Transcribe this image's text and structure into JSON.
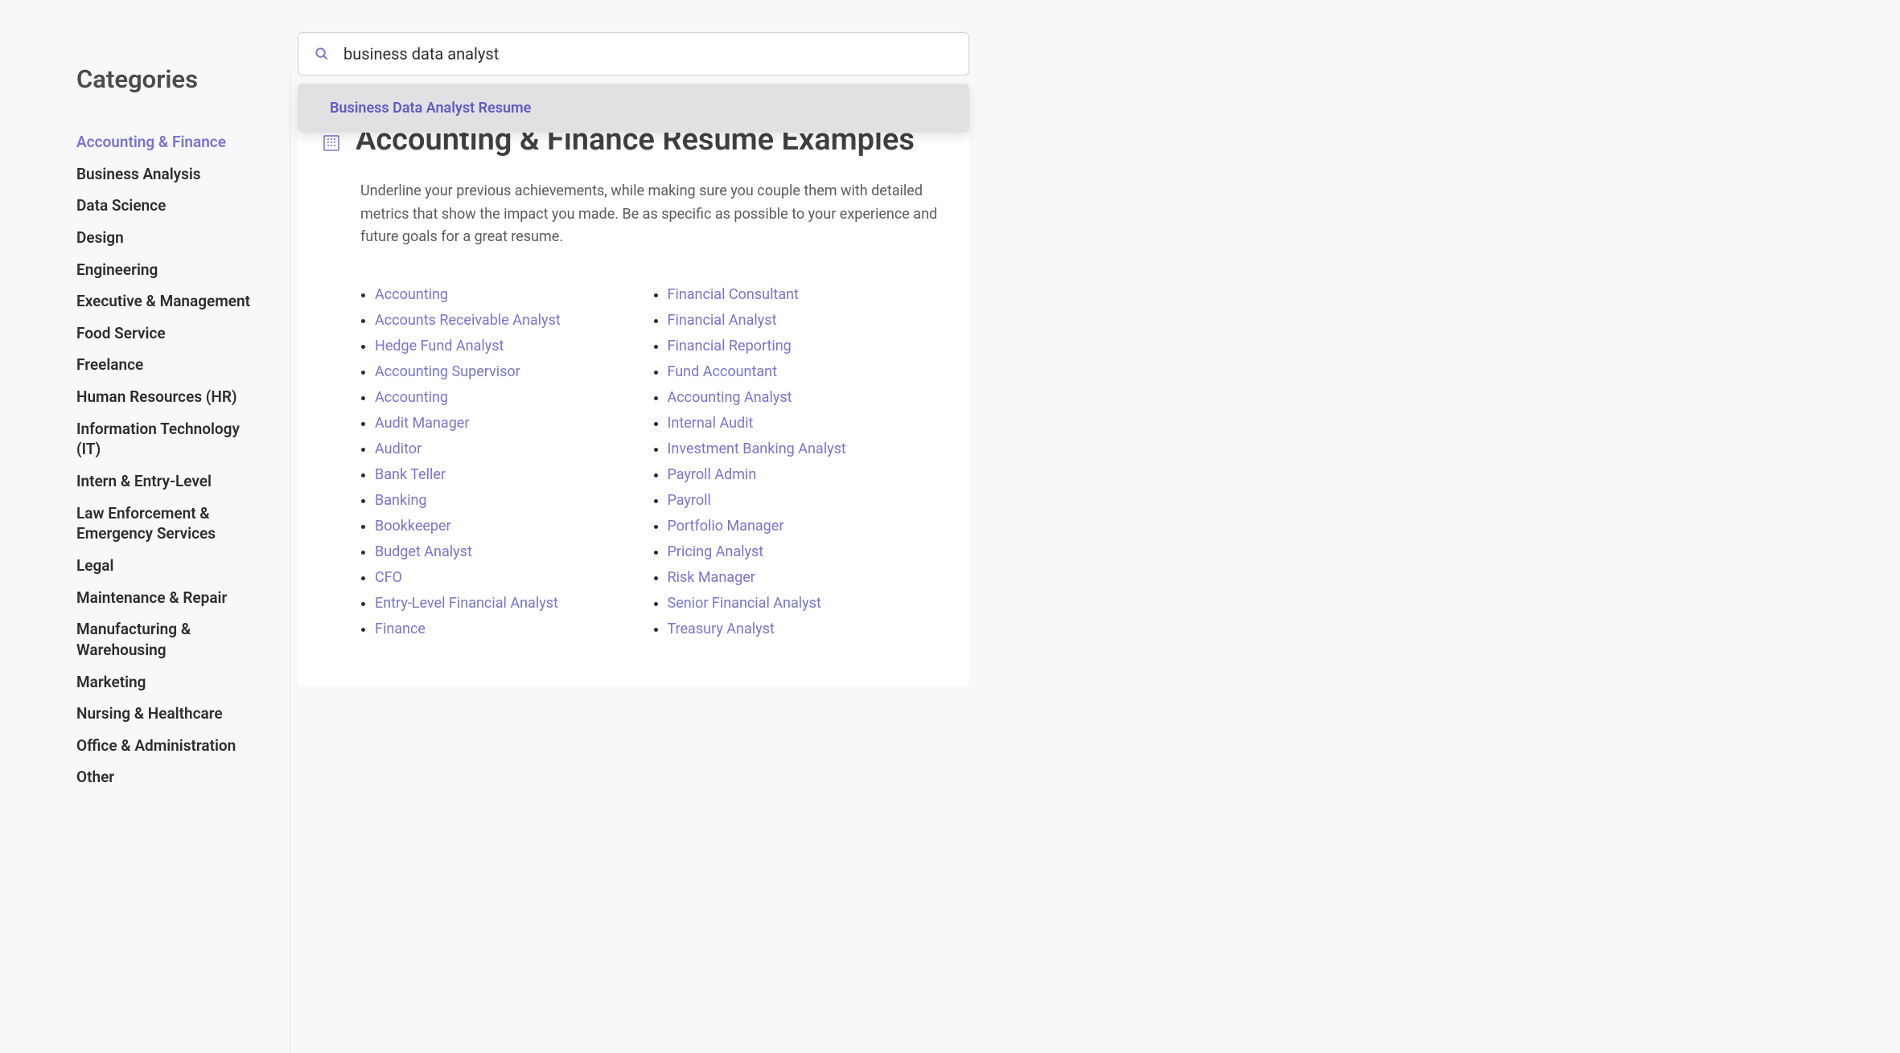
{
  "sidebar": {
    "heading": "Categories",
    "items": [
      {
        "label": "Accounting & Finance",
        "active": true
      },
      {
        "label": "Business Analysis",
        "active": false
      },
      {
        "label": "Data Science",
        "active": false
      },
      {
        "label": "Design",
        "active": false
      },
      {
        "label": "Engineering",
        "active": false
      },
      {
        "label": "Executive & Management",
        "active": false
      },
      {
        "label": "Food Service",
        "active": false
      },
      {
        "label": "Freelance",
        "active": false
      },
      {
        "label": "Human Resources (HR)",
        "active": false
      },
      {
        "label": "Information Technology (IT)",
        "active": false
      },
      {
        "label": "Intern & Entry-Level",
        "active": false
      },
      {
        "label": "Law Enforcement & Emergency Services",
        "active": false
      },
      {
        "label": "Legal",
        "active": false
      },
      {
        "label": "Maintenance & Repair",
        "active": false
      },
      {
        "label": "Manufacturing & Warehousing",
        "active": false
      },
      {
        "label": "Marketing",
        "active": false
      },
      {
        "label": "Nursing & Healthcare",
        "active": false
      },
      {
        "label": "Office & Administration",
        "active": false
      },
      {
        "label": "Other",
        "active": false
      }
    ]
  },
  "search": {
    "value": "business data analyst",
    "placeholder": "",
    "suggestions": [
      "Business Data Analyst Resume"
    ]
  },
  "card": {
    "title": "Accounting & Finance Resume Examples",
    "description": "Underline your previous achievements, while making sure you couple them with detailed metrics that show the impact you made. Be as specific as possible to your experience and future goals for a great resume.",
    "examples_left": [
      "Accounting",
      "Accounts Receivable Analyst",
      "Hedge Fund Analyst",
      "Accounting Supervisor",
      "Accounting",
      "Audit Manager",
      "Auditor",
      "Bank Teller",
      "Banking",
      "Bookkeeper",
      "Budget Analyst",
      "CFO",
      "Entry-Level Financial Analyst",
      "Finance"
    ],
    "examples_right": [
      "Financial Consultant",
      "Financial Analyst",
      "Financial Reporting",
      "Fund Accountant",
      "Accounting Analyst",
      "Internal Audit",
      "Investment Banking Analyst",
      "Payroll Admin",
      "Payroll",
      "Portfolio Manager",
      "Pricing Analyst",
      "Risk Manager",
      "Senior Financial Analyst",
      "Treasury Analyst"
    ]
  },
  "colors": {
    "accent": "#7b73d1"
  }
}
